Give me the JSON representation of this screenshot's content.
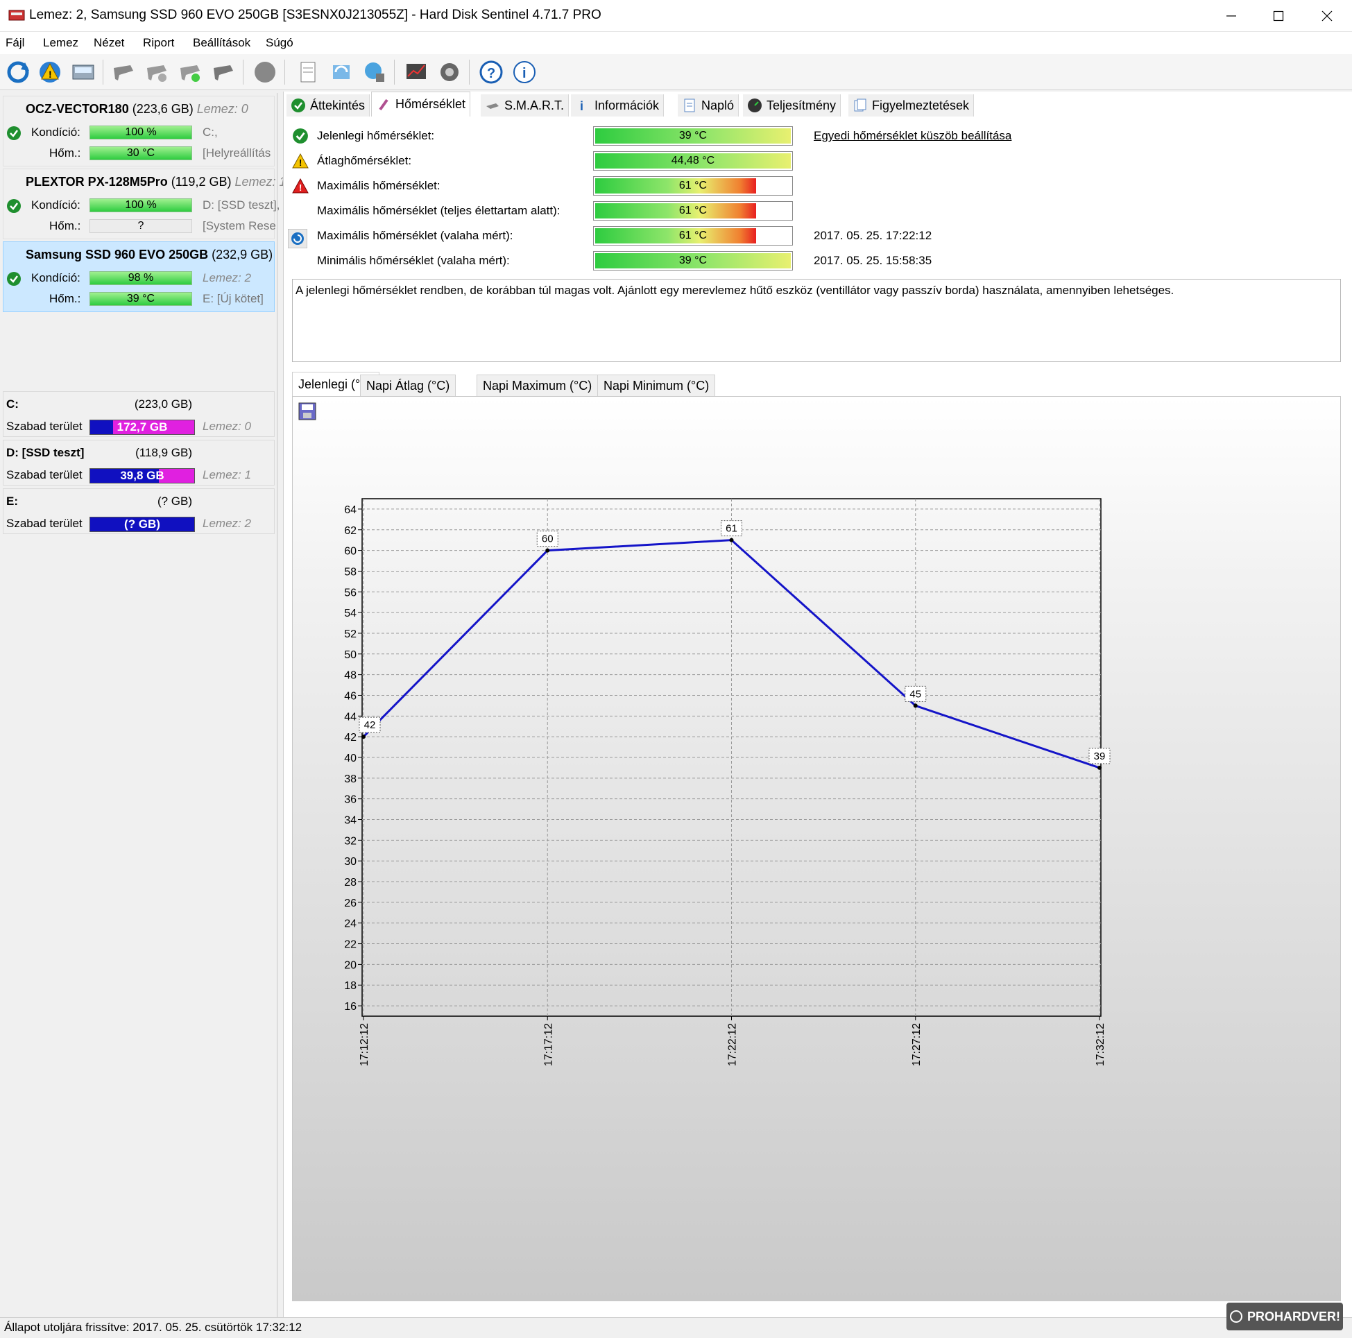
{
  "window": {
    "title": "Lemez: 2, Samsung SSD 960 EVO 250GB [S3ESNX0J213055Z]  -  Hard Disk Sentinel 4.71.7 PRO"
  },
  "menu": [
    "Fájl",
    "Lemez",
    "Nézet",
    "Riport",
    "Beállítások",
    "Súgó"
  ],
  "disks": [
    {
      "name": "OCZ-VECTOR180",
      "size": "(223,6 GB)",
      "lemez": "Lemez: 0",
      "condition_label": "Kondíció:",
      "condition": "100 %",
      "condition_pct": 100,
      "temp_label": "Hőm.:",
      "temp": "30 °C",
      "info1": "C:,",
      "info2": "[Helyreállítás"
    },
    {
      "name": "PLEXTOR PX-128M5Pro",
      "size": "(119,2 GB)",
      "lemez": "Lemez: 1",
      "condition_label": "Kondíció:",
      "condition": "100 %",
      "condition_pct": 100,
      "temp_label": "Hőm.:",
      "temp": "?",
      "info1": "D: [SSD teszt],",
      "info2": "[System Rese"
    },
    {
      "name": "Samsung SSD 960 EVO 250GB",
      "size": "(232,9 GB)",
      "lemez": "Lemez: 2",
      "condition_label": "Kondíció:",
      "condition": "98 %",
      "condition_pct": 98,
      "temp_label": "Hőm.:",
      "temp": "39 °C",
      "info1": "Lemez: 2",
      "info2": "E: [Új kötet]"
    }
  ],
  "volumes": [
    {
      "name": "C:",
      "size": "(223,0 GB)",
      "free_label": "Szabad terület",
      "free": "172,7 GB",
      "lemez": "Lemez: 0"
    },
    {
      "name": "D: [SSD teszt]",
      "size": "(118,9 GB)",
      "free_label": "Szabad terület",
      "free": "39,8 GB",
      "lemez": "Lemez: 1"
    },
    {
      "name": "E:",
      "size": "(? GB)",
      "free_label": "Szabad terület",
      "free": "(? GB)",
      "lemez": "Lemez: 2"
    }
  ],
  "tabs": [
    "Áttekintés",
    "Hőmérséklet",
    "S.M.A.R.T.",
    "Információk",
    "Napló",
    "Teljesítmény",
    "Figyelmeztetések"
  ],
  "temps": {
    "current_label": "Jelenlegi hőmérséklet:",
    "current": "39 °C",
    "avg_label": "Átlaghőmérséklet:",
    "avg": "44,48 °C",
    "max_label": "Maximális hőmérséklet:",
    "max": "61 °C",
    "max_life_label": "Maximális hőmérséklet (teljes élettartam alatt):",
    "max_life": "61 °C",
    "max_ever_label": "Maximális hőmérséklet (valaha mért):",
    "max_ever": "61 °C",
    "max_ever_date": "2017. 05. 25. 17:22:12",
    "min_ever_label": "Minimális hőmérséklet (valaha mért):",
    "min_ever": "39 °C",
    "min_ever_date": "2017. 05. 25. 15:58:35",
    "threshold_link": "Egyedi hőmérséklet küszöb beállítása"
  },
  "advice": "A jelenlegi hőmérséklet rendben, de korábban túl magas volt. Ajánlott egy merevlemez hűtő eszköz (ventillátor vagy passzív borda) használata, amennyiben lehetséges.",
  "chart_tabs": [
    "Jelenlegi (°C)",
    "Napi Átlag (°C)",
    "Napi Maximum (°C)",
    "Napi Minimum (°C)"
  ],
  "chart_data": {
    "type": "line",
    "title": "",
    "xlabel": "",
    "ylabel": "",
    "x": [
      "17:12:12",
      "17:17:12",
      "17:22:12",
      "17:27:12",
      "17:32:12"
    ],
    "series": [
      {
        "values": [
          42,
          60,
          61,
          45,
          39
        ]
      }
    ],
    "ylim": [
      15,
      65
    ],
    "yticks": [
      16,
      18,
      20,
      22,
      24,
      26,
      28,
      30,
      32,
      34,
      36,
      38,
      40,
      42,
      44,
      46,
      48,
      50,
      52,
      54,
      56,
      58,
      60,
      62,
      64
    ],
    "grid": true,
    "line_color": "#1414c8"
  },
  "status": "Állapot utoljára frissítve: 2017. 05. 25. csütörtök 17:32:12",
  "watermark": "PROHARDVER!"
}
